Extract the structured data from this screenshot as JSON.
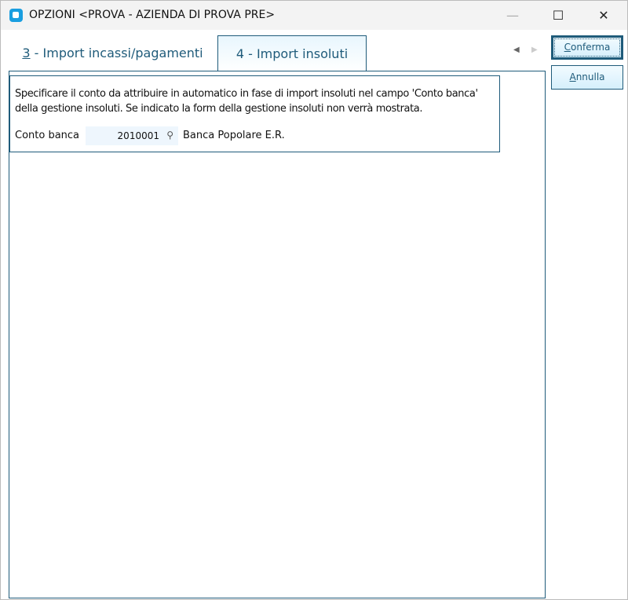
{
  "window": {
    "title": "OPZIONI <PROVA - AZIENDA DI PROVA PRE>",
    "minimize": "—",
    "maximize": "☐",
    "close": "✕"
  },
  "tabs": [
    {
      "key": "3",
      "label": " - Import incassi/pagamenti"
    },
    {
      "label": "4 - Import insoluti"
    }
  ],
  "nav": {
    "prev": "◀",
    "next": "▶"
  },
  "group": {
    "description_line1": "Specificare il conto da attribuire in automatico in fase di import insoluti nel campo 'Conto banca'",
    "description_line2": "della gestione insoluti. Se indicato la form della gestione insoluti non verrà mostrata.",
    "field_label": "Conto banca",
    "field_value": "2010001",
    "account_name": "Banca Popolare E.R."
  },
  "buttons": {
    "confirm_key": "C",
    "confirm_rest": "onferma",
    "cancel_key": "A",
    "cancel_rest": "nnulla"
  }
}
